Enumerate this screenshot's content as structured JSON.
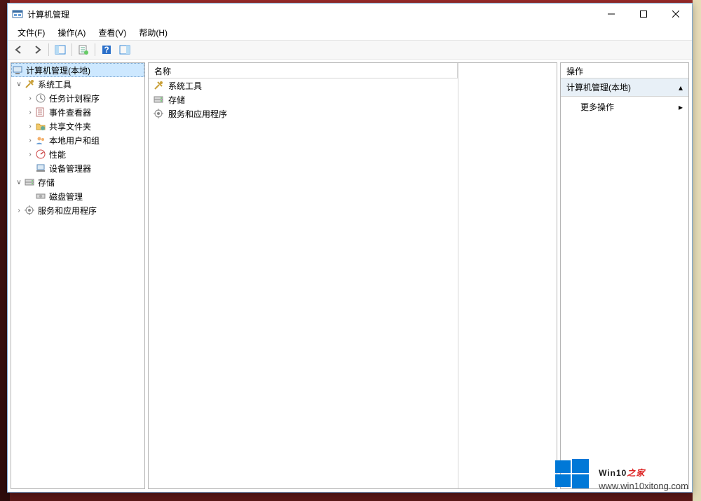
{
  "window": {
    "title": "计算机管理"
  },
  "menu": {
    "file": "文件(F)",
    "action": "操作(A)",
    "view": "查看(V)",
    "help": "帮助(H)"
  },
  "tree": {
    "root": "计算机管理(本地)",
    "system_tools": "系统工具",
    "task_scheduler": "任务计划程序",
    "event_viewer": "事件查看器",
    "shared_folders": "共享文件夹",
    "local_users": "本地用户和组",
    "performance": "性能",
    "device_manager": "设备管理器",
    "storage": "存储",
    "disk_management": "磁盘管理",
    "services_apps": "服务和应用程序"
  },
  "list": {
    "header_name": "名称",
    "items": [
      {
        "label": "系统工具",
        "icon": "tools"
      },
      {
        "label": "存储",
        "icon": "storage"
      },
      {
        "label": "服务和应用程序",
        "icon": "services"
      }
    ]
  },
  "actions": {
    "header": "操作",
    "group": "计算机管理(本地)",
    "more": "更多操作"
  },
  "watermark": {
    "brand": "Win10",
    "brand_accent": "之家",
    "url": "www.win10xitong.com"
  }
}
